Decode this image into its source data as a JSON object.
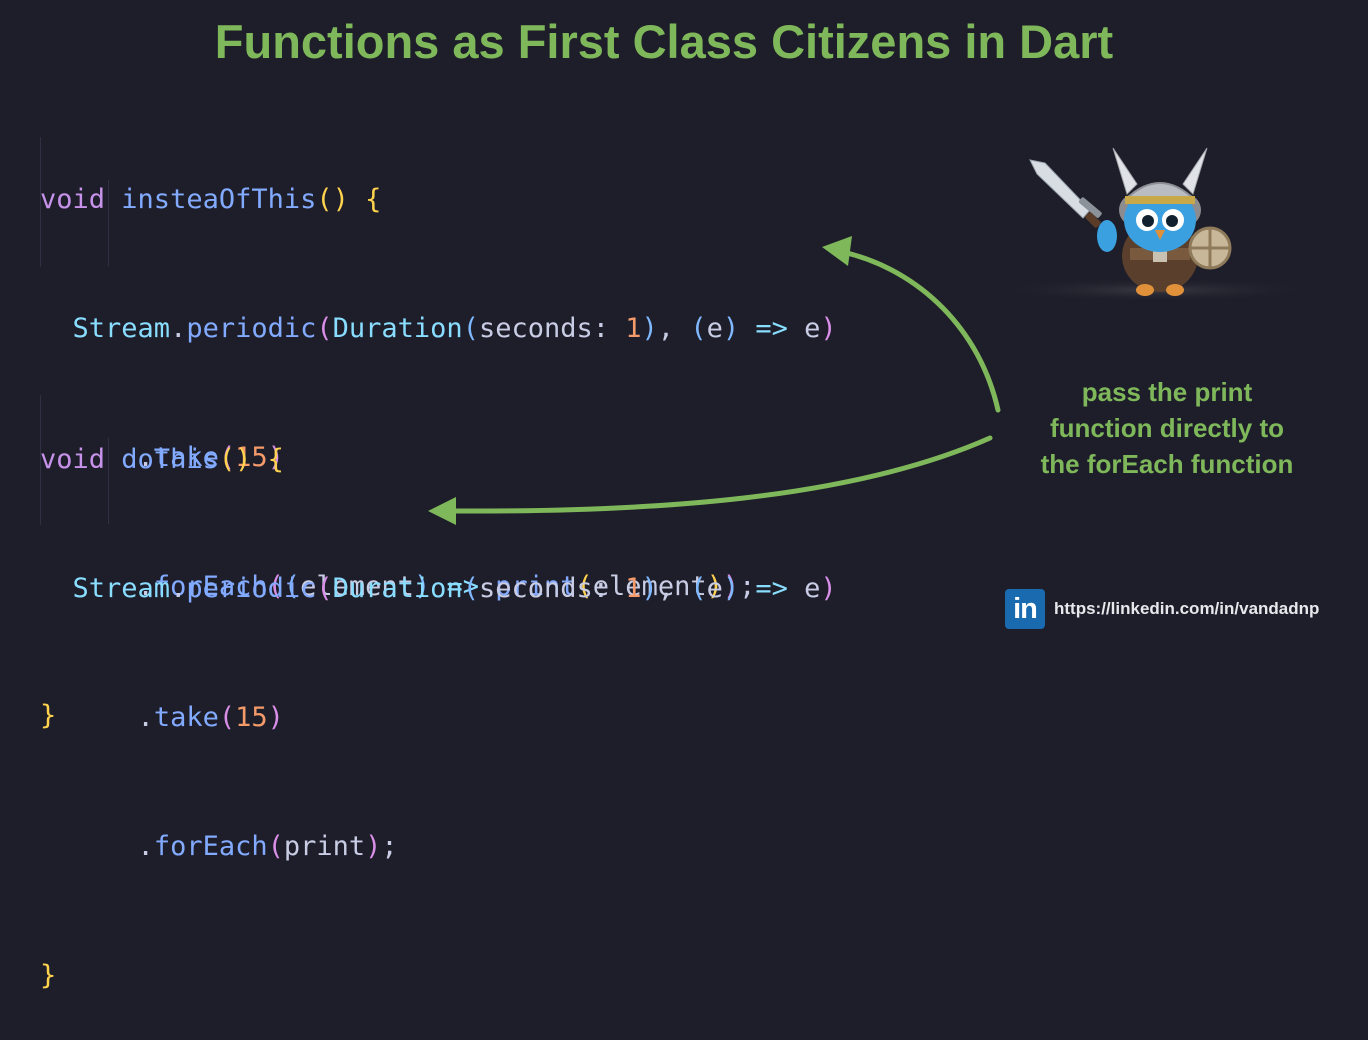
{
  "title": "Functions as First Class Citizens in Dart",
  "code_block_1": {
    "kw_void": "void",
    "fn_name": "insteaOfThis",
    "l2_type_stream": "Stream",
    "l2_periodic": "periodic",
    "l2_type_duration": "Duration",
    "l2_param": "seconds:",
    "l2_num": "1",
    "l2_param_e": "e",
    "l2_arrow": "=>",
    "l2_ret_e": "e",
    "l3_take": "take",
    "l3_num": "15",
    "l4_foreach": "forEach",
    "l4_param": "element",
    "l4_arrow": "=>",
    "l4_print": "print",
    "l4_arg": "element"
  },
  "code_block_2": {
    "kw_void": "void",
    "fn_name": "doThis",
    "l2_type_stream": "Stream",
    "l2_periodic": "periodic",
    "l2_type_duration": "Duration",
    "l2_param": "seconds:",
    "l2_num": "1",
    "l2_param_e": "e",
    "l2_arrow": "=>",
    "l2_ret_e": "e",
    "l3_take": "take",
    "l3_num": "15",
    "l4_foreach": "forEach",
    "l4_print": "print"
  },
  "annotation": {
    "lines": [
      "pass the print",
      "function directly to",
      "the forEach function"
    ]
  },
  "footer": {
    "logo_text": "in",
    "url": "https://linkedin.com/in/vandadnp"
  },
  "colors": {
    "background": "#1e1e2a",
    "accent_green": "#7fb85a",
    "keyword": "#c792ea",
    "function": "#82aaff",
    "type": "#89ddff",
    "number": "#f59b6a",
    "bracket_gold": "#ffd34e",
    "bracket_magenta": "#d98ee8",
    "bracket_blue": "#7fb8ff",
    "linkedin_blue": "#1a6ab0"
  },
  "icons": [
    "dart-viking-mascot",
    "linkedin-logo-icon",
    "curved-arrow-icon"
  ]
}
